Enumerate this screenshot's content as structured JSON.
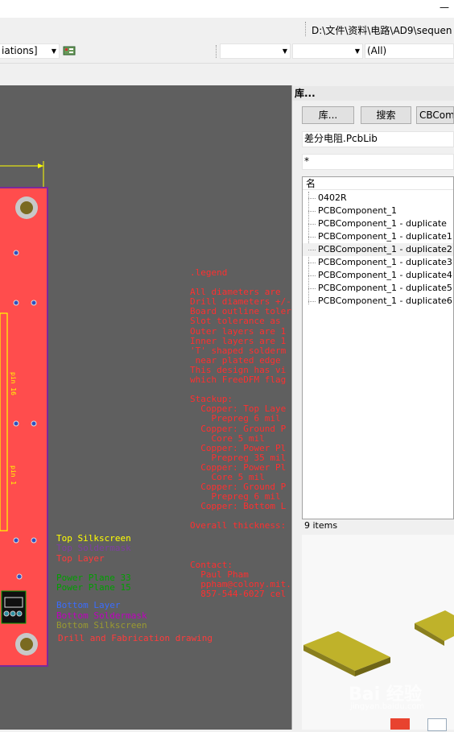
{
  "window": {
    "minimize_glyph": "—",
    "path": "D:\\文件\\资料\\电路\\AD9\\sequen"
  },
  "toolbar": {
    "variations_combo": "iations]",
    "filter_combo": "(All)"
  },
  "pcb": {
    "pin_label_1": "pin 16",
    "pin_label_2": "pin 1",
    "notes": [
      ".legend",
      "",
      "All diameters are",
      "Drill diameters +/-",
      "Board outline toler",
      "Slot tolerance as",
      "Outer layers are 1",
      "Inner layers are 1",
      "'T' shaped solderm",
      " near plated edge",
      "This design has vi",
      "which FreeDFM flag",
      "",
      "Stackup:",
      "  Copper: Top Laye",
      "    Prepreg 6 mil",
      "  Copper: Ground P",
      "    Core 5 mil",
      "  Copper: Power Pl",
      "    Prepreg 35 mil",
      "  Copper: Power Pl",
      "    Core 5 mil",
      "  Copper: Ground P",
      "    Prepreg 6 mil",
      "  Copper: Bottom L",
      "",
      "Overall thickness:"
    ],
    "contact": [
      "Contact:",
      "  Paul Pham",
      "  ppham@colony.mit.",
      "  857-544-6027 cel"
    ],
    "legend": [
      {
        "text": "Top Silkscreen",
        "color": "#ffff00"
      },
      {
        "text": "Top Soldermask",
        "color": "#7f3fa0"
      },
      {
        "text": "Top Layer",
        "color": "#ff3b3b"
      },
      {
        "text": "Power Plane 33",
        "color": "#00a000"
      },
      {
        "text": "Power Plane 15",
        "color": "#00a000"
      },
      {
        "text": "Bottom Layer",
        "color": "#3a6cff"
      },
      {
        "text": "Bottom Soldermask",
        "color": "#c000c0"
      },
      {
        "text": "Bottom Silkscreen",
        "color": "#9a9a30"
      },
      {
        "text": "Drill and Fabrication drawing",
        "color": "#ff3b3b"
      }
    ]
  },
  "library": {
    "title": "库...",
    "lib_button": "库...",
    "search_button": "搜索",
    "component_button": "CBCompo",
    "library_name": "差分电阻.PcbLib",
    "filter_value": "*",
    "column_header": "名",
    "items": [
      "0402R",
      "PCBComponent_1",
      "PCBComponent_1 - duplicate",
      "PCBComponent_1 - duplicate1",
      "PCBComponent_1 - duplicate2",
      "PCBComponent_1 - duplicate3",
      "PCBComponent_1 - duplicate4",
      "PCBComponent_1 - duplicate5",
      "PCBComponent_1 - duplicate6"
    ],
    "item_count": "9 items"
  },
  "watermark": {
    "text": "Bai 经验",
    "url": "jingyan.baidu.com"
  }
}
